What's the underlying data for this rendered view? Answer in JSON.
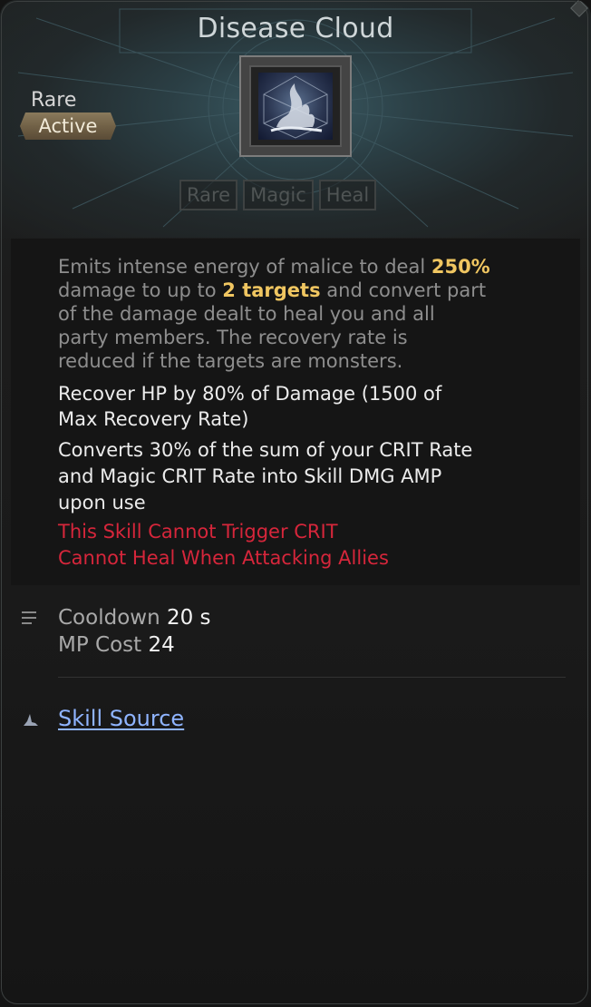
{
  "tooltip": {
    "title": "Disease Cloud",
    "rarity": "Rare",
    "skill_type": "Active",
    "skill_icon": "smoke-flame-icon",
    "tags": [
      "Rare",
      "Magic",
      "Heal"
    ]
  },
  "description": {
    "intro_1": "Emits intense energy of malice to deal ",
    "damage_pct": "250%",
    "intro_2": "damage to up to ",
    "targets": "2 targets",
    "intro_3": " and convert part",
    "intro_4": "of the damage dealt to heal you and all",
    "intro_5": "party members. The recovery rate is",
    "intro_6": "reduced if the targets are monsters.",
    "recover_1": "Recover HP by 80% of Damage (1500 of",
    "recover_2": "Max Recovery Rate)",
    "convert_1": "Converts 30% of the sum of your CRIT Rate",
    "convert_2": "and Magic CRIT Rate into Skill DMG AMP",
    "convert_3": "upon use",
    "warning_1": "This Skill Cannot Trigger CRIT",
    "warning_2": "Cannot Heal When Attacking Allies"
  },
  "stats": {
    "cooldown_label": "Cooldown",
    "cooldown_value": "20 s",
    "mp_label": "MP Cost",
    "mp_value": "24"
  },
  "source": {
    "link_label": "Skill Source"
  },
  "colors": {
    "highlight": "#f0c661",
    "warning": "#d6263b",
    "link": "#8fb4ff"
  }
}
